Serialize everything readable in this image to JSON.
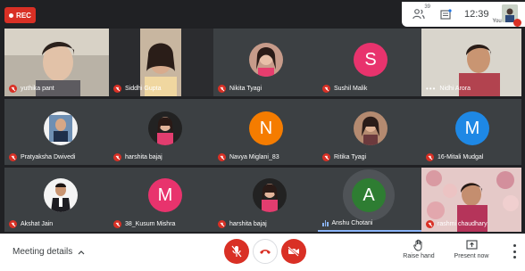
{
  "recording": {
    "label": "REC"
  },
  "topbar": {
    "participants_count": "39",
    "time": "12:39",
    "you_label": "You"
  },
  "tiles": [
    {
      "name": "yuthika pant"
    },
    {
      "name": "Siddhi Gupta"
    },
    {
      "name": "Nikita Tyagi"
    },
    {
      "name": "Sushil Malik",
      "initial": "S"
    },
    {
      "name": "Nidhi Arora"
    },
    {
      "name": "Pratyaksha Dwivedi"
    },
    {
      "name": "harshita bajaj"
    },
    {
      "name": "Navya Miglani_83",
      "initial": "N"
    },
    {
      "name": "Ritika Tyagi"
    },
    {
      "name": "16-Mitali Mudgal",
      "initial": "M"
    },
    {
      "name": "Akshat Jain"
    },
    {
      "name": "38_Kusum Mishra",
      "initial": "M"
    },
    {
      "name": "harshita bajaj"
    },
    {
      "name": "Anshu Chotani",
      "initial": "A"
    },
    {
      "name": "rashmi chaudhary"
    }
  ],
  "colors": {
    "muted": "#d93025",
    "avatar_pink": "#e8336d",
    "avatar_orange": "#f57c00",
    "avatar_blue": "#1e88e5",
    "avatar_green": "#2e7d32"
  },
  "bottombar": {
    "meeting_details": "Meeting details",
    "raise_hand": "Raise hand",
    "present_now": "Present now"
  }
}
